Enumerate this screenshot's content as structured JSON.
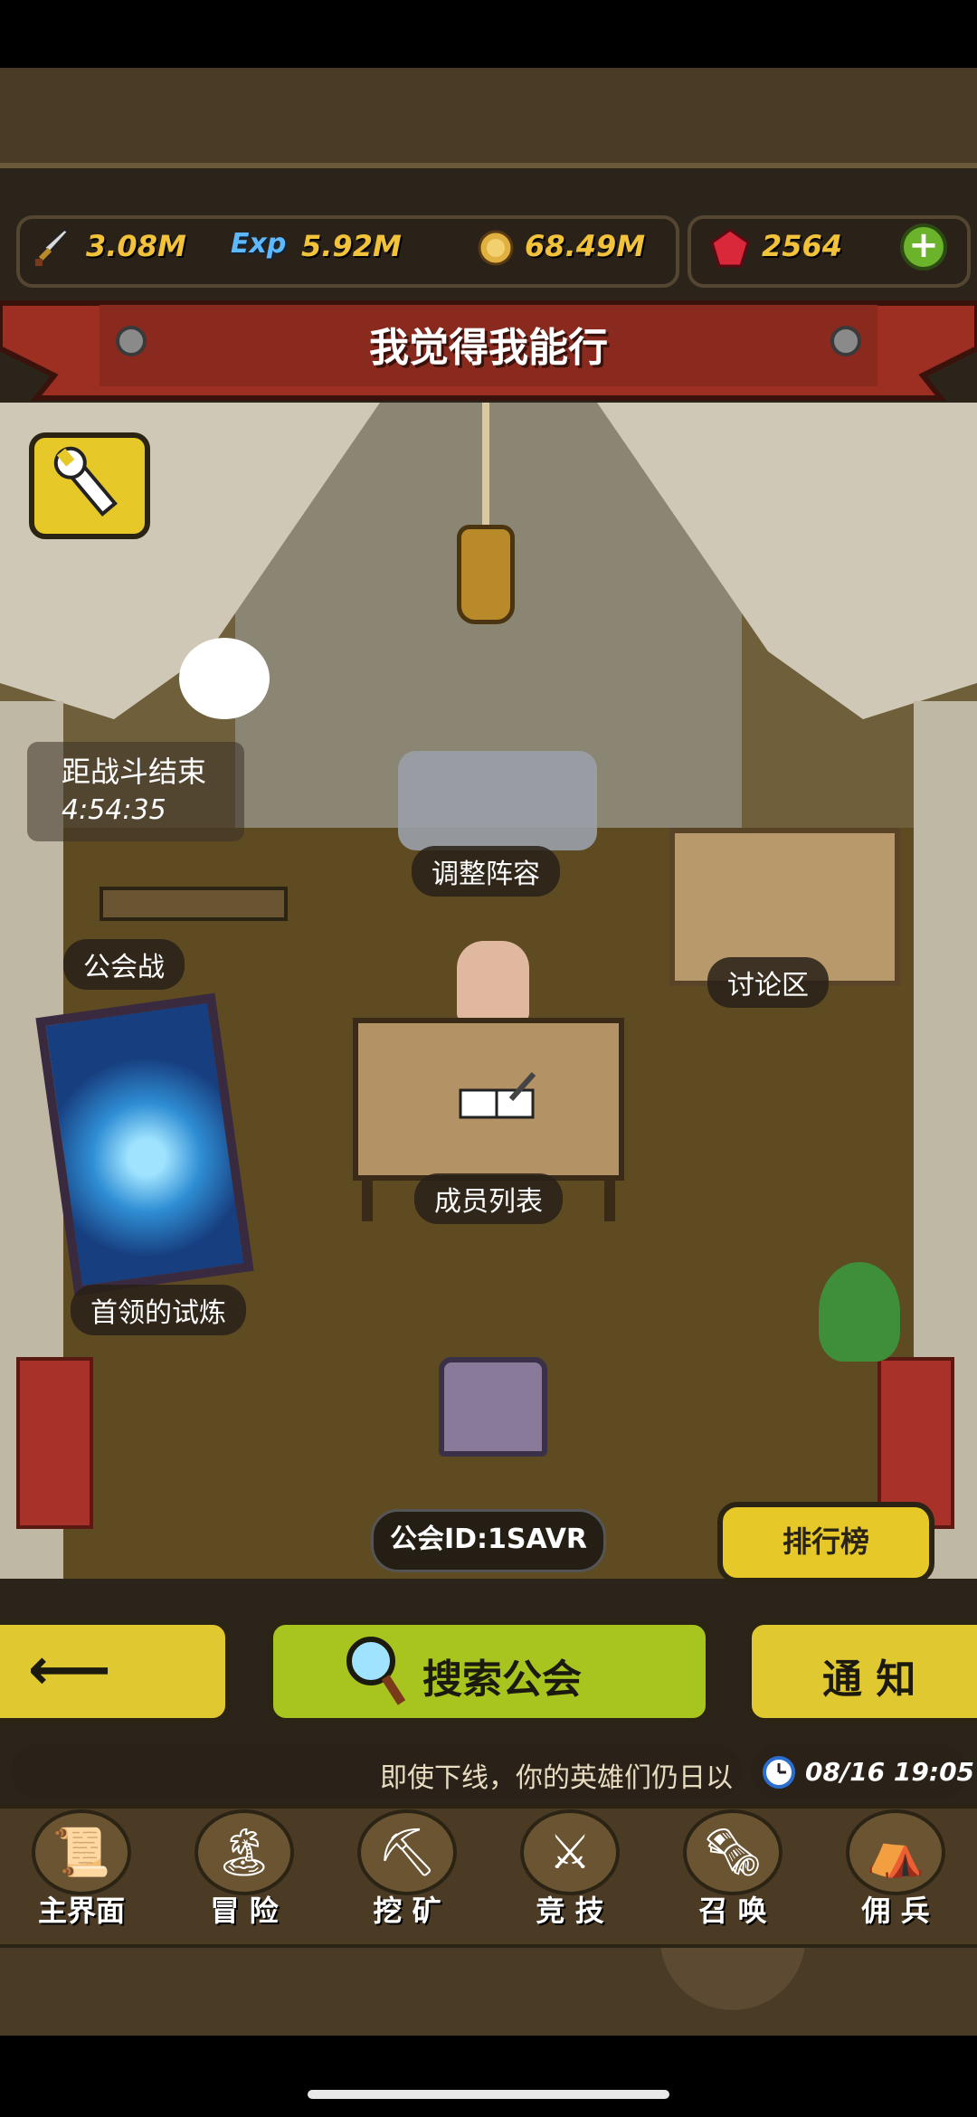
{
  "resources": {
    "sword_value": "3.08M",
    "exp_value": "5.92M",
    "coin_value": "68.49M",
    "gem_value": "2564",
    "exp_icon_text": "Exp"
  },
  "guild": {
    "name": "我觉得我能行",
    "id_label": "公会ID:1SAVR"
  },
  "scene": {
    "battle_timer_label": "距战斗结束",
    "battle_timer_value": "4:54:35",
    "guild_war": "公会战",
    "formation": "调整阵容",
    "discussion": "讨论区",
    "member_list": "成员列表",
    "boss_trial": "首领的试炼",
    "ranking": "排行榜"
  },
  "actions": {
    "back_label": "⟵",
    "search_label": "搜索公会",
    "notice_label": "通 知"
  },
  "ticker": {
    "text": "即使下线，你的英雄们仍日以",
    "datetime": "08/16 19:05"
  },
  "nav": [
    {
      "label": "主界面",
      "icon": "scroll-map-icon"
    },
    {
      "label": "冒 险",
      "icon": "island-icon"
    },
    {
      "label": "挖 矿",
      "icon": "pickaxe-icon"
    },
    {
      "label": "竞 技",
      "icon": "crossed-swords-icon"
    },
    {
      "label": "召 唤",
      "icon": "summon-scroll-icon"
    },
    {
      "label": "佣 兵",
      "icon": "tent-icon"
    }
  ],
  "colors": {
    "accent_yellow": "#e6c928",
    "search_green": "#a8c41e",
    "banner_red": "#9c2f22",
    "gold_text": "#f2c23a"
  }
}
